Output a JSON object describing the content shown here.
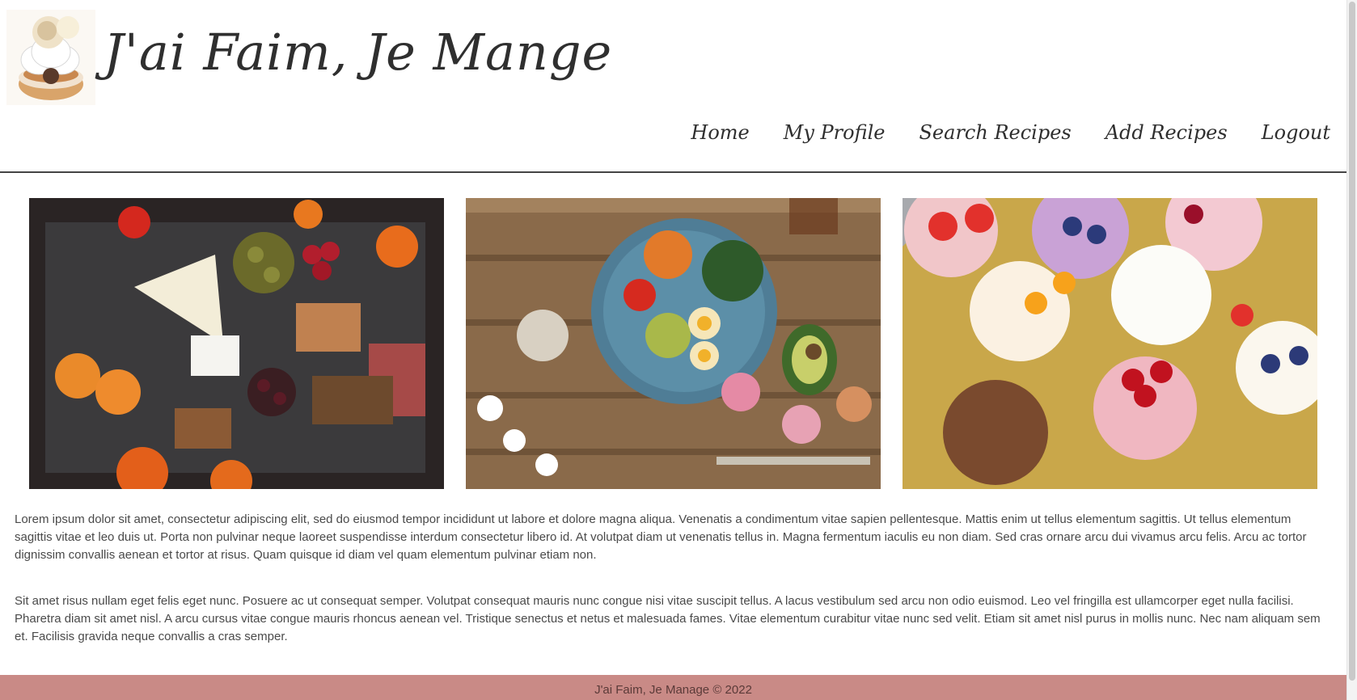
{
  "header": {
    "site_title": "J'ai Faim, Je Mange",
    "logo_icon": "macaron-cake-logo"
  },
  "nav": {
    "items": [
      {
        "label": "Home"
      },
      {
        "label": "My Profile"
      },
      {
        "label": "Search Recipes"
      },
      {
        "label": "Add Recipes"
      },
      {
        "label": "Logout"
      }
    ]
  },
  "gallery": {
    "images": [
      {
        "name": "charcuterie-board-photo"
      },
      {
        "name": "salad-bowl-photo"
      },
      {
        "name": "mini-cheesecakes-photo"
      }
    ]
  },
  "content": {
    "paragraphs": [
      "Lorem ipsum dolor sit amet, consectetur adipiscing elit, sed do eiusmod tempor incididunt ut labore et dolore magna aliqua. Venenatis a condimentum vitae sapien pellentesque. Mattis enim ut tellus elementum sagittis. Ut tellus elementum sagittis vitae et leo duis ut. Porta non pulvinar neque laoreet suspendisse interdum consectetur libero id. At volutpat diam ut venenatis tellus in. Magna fermentum iaculis eu non diam. Sed cras ornare arcu dui vivamus arcu felis. Arcu ac tortor dignissim convallis aenean et tortor at risus. Quam quisque id diam vel quam elementum pulvinar etiam non.",
      "Sit amet risus nullam eget felis eget nunc. Posuere ac ut consequat semper. Volutpat consequat mauris nunc congue nisi vitae suscipit tellus. A lacus vestibulum sed arcu non odio euismod. Leo vel fringilla est ullamcorper eget nulla facilisi. Pharetra diam sit amet nisl. A arcu cursus vitae congue mauris rhoncus aenean vel. Tristique senectus et netus et malesuada fames. Vitae elementum curabitur vitae nunc sed velit. Etiam sit amet nisl purus in mollis nunc. Nec nam aliquam sem et. Facilisis gravida neque convallis a cras semper."
    ]
  },
  "footer": {
    "text": "J'ai Faim, Je Manage © 2022"
  },
  "colors": {
    "footer_bg": "#c98a86",
    "text": "#4a4a4a",
    "title": "#2f2f2f"
  }
}
